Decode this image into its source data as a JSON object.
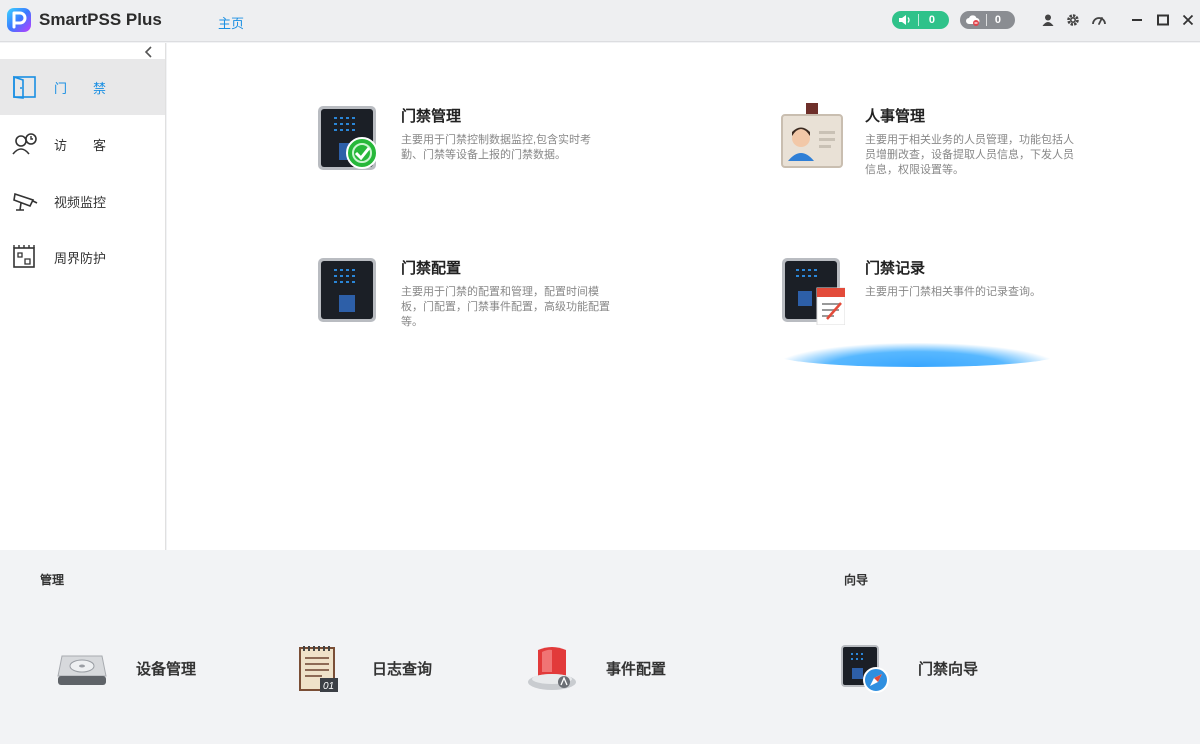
{
  "app": {
    "title": "SmartPSS Plus",
    "home_tab": "主页"
  },
  "status": {
    "alarm_count": "0",
    "offline_count": "0"
  },
  "sidebar": {
    "items": [
      {
        "label": "门禁",
        "icon": "door-icon",
        "active": true
      },
      {
        "label": "访客",
        "icon": "visitor-icon",
        "active": false
      },
      {
        "label": "视频监控",
        "icon": "camera-icon",
        "active": false
      },
      {
        "label": "周界防护",
        "icon": "perimeter-icon",
        "active": false
      }
    ]
  },
  "cards": [
    {
      "title": "门禁管理",
      "desc": "主要用于门禁控制数据监控,包含实时考勤、门禁等设备上报的门禁数据。",
      "icon": "access-control-device-icon"
    },
    {
      "title": "人事管理",
      "desc": "主要用于相关业务的人员管理，功能包括人员增删改查，设备提取人员信息，下发人员信息，权限设置等。",
      "icon": "id-badge-icon"
    },
    {
      "title": "门禁配置",
      "desc": "主要用于门禁的配置和管理，配置时间模板，门配置，门禁事件配置，高级功能配置等。",
      "icon": "access-device-icon"
    },
    {
      "title": "门禁记录",
      "desc": "主要用于门禁相关事件的记录查询。",
      "icon": "access-record-icon"
    }
  ],
  "bottom": {
    "manage_title": "管理",
    "wizard_title": "向导",
    "tools": [
      {
        "label": "设备管理",
        "icon": "device-drive-icon"
      },
      {
        "label": "日志查询",
        "icon": "log-notepad-icon"
      },
      {
        "label": "事件配置",
        "icon": "alarm-light-icon"
      },
      {
        "label": "门禁向导",
        "icon": "wizard-compass-icon"
      }
    ]
  },
  "colors": {
    "accent": "#1a8fe3",
    "status_green": "#2fc28a",
    "status_gray": "#8a8d92"
  }
}
